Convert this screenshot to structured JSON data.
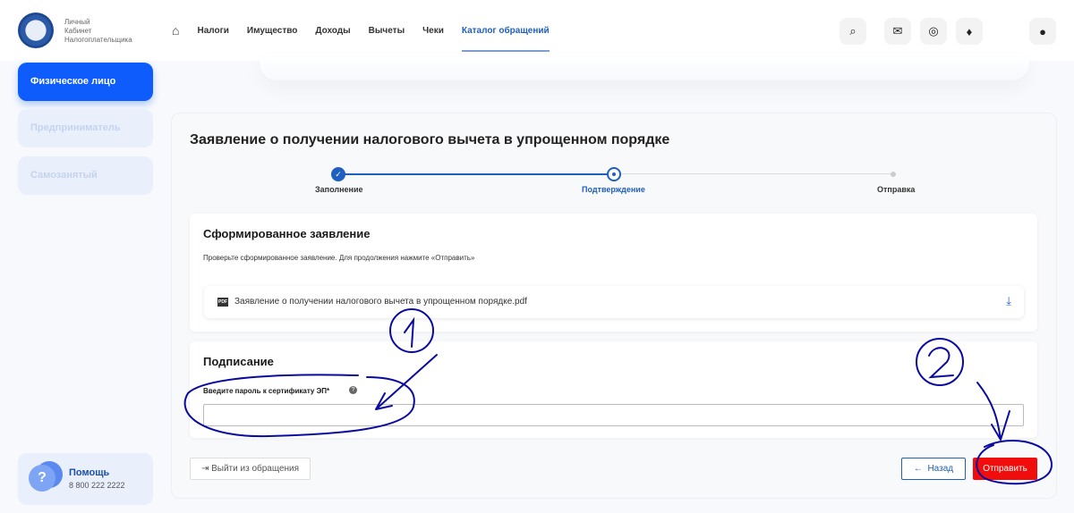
{
  "header": {
    "logo_text": [
      "Личный",
      "Кабинет",
      "Налогоплательщика"
    ],
    "nav": [
      "Налоги",
      "Имущество",
      "Доходы",
      "Вычеты",
      "Чеки",
      "Каталог обращений"
    ]
  },
  "sidebar": {
    "items": [
      "Физическое лицо",
      "Предприниматель",
      "Самозанятый"
    ],
    "help_title": "Помощь",
    "help_phone": "8 800 222 2222"
  },
  "main": {
    "title": "Заявление о получении налогового вычета в упрощенном порядке",
    "steps": [
      "Заполнение",
      "Подтверждение",
      "Отправка"
    ],
    "generated": {
      "title": "Сформированное заявление",
      "hint": "Проверьте сформированное заявление. Для продолжения нажмите «Отправить»",
      "file_badge": "PDF",
      "file_name": "Заявление о получении налогового вычета в упрощенном порядке.pdf"
    },
    "signing": {
      "title": "Подписание",
      "label": "Введите пароль к сертификату ЭП*",
      "help": "?",
      "password": ""
    },
    "exit_label": "Выйти из обращения",
    "back_label": "Назад",
    "send_label": "Отправить"
  },
  "annotations": [
    "1",
    "2"
  ],
  "colors": {
    "accent": "#0d5cfb",
    "send": "#f20d0d",
    "ink": "#0a0aa0"
  }
}
